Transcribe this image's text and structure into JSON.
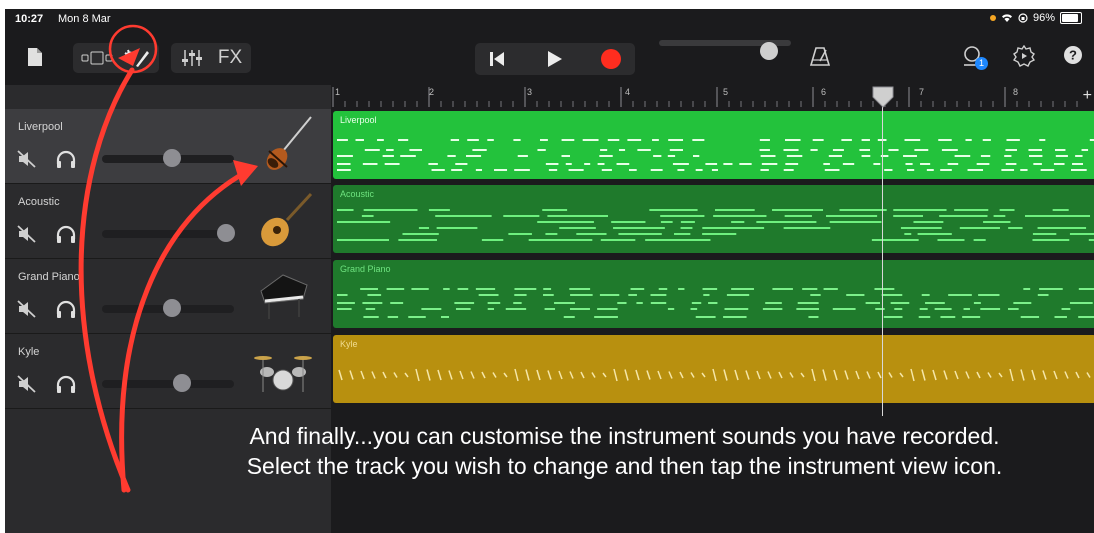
{
  "status": {
    "time": "10:27",
    "date": "Mon 8 Mar",
    "battery": "96%"
  },
  "toolbar": {
    "fx_label": "FX",
    "notification_count": "1"
  },
  "ruler": {
    "bars": [
      "1",
      "2",
      "3",
      "4",
      "5",
      "6",
      "7",
      "8"
    ],
    "add": "+"
  },
  "tracks": [
    {
      "name": "Liverpool",
      "region_label": "Liverpool",
      "color": "#23c23c",
      "label_color": "#e9ffe9",
      "selected": true,
      "volume": 0.52
    },
    {
      "name": "Acoustic",
      "region_label": "Acoustic",
      "color": "#1f7a2c",
      "label_color": "#6ee37f",
      "selected": false,
      "volume": 0.95
    },
    {
      "name": "Grand Piano",
      "region_label": "Grand Piano",
      "color": "#1f7a2c",
      "label_color": "#6ee37f",
      "selected": false,
      "volume": 0.52
    },
    {
      "name": "Kyle",
      "region_label": "Kyle",
      "color": "#b8900f",
      "label_color": "#f0dc90",
      "selected": false,
      "volume": 0.6
    }
  ],
  "annotation": {
    "line1": "And finally...you can customise the instrument sounds you have recorded.",
    "line2": "Select the track you wish to change and then tap the instrument view icon."
  },
  "colors": {
    "record": "#ff2d1f",
    "accent_arrow": "#ff3b30",
    "badge": "#1e88ff"
  }
}
